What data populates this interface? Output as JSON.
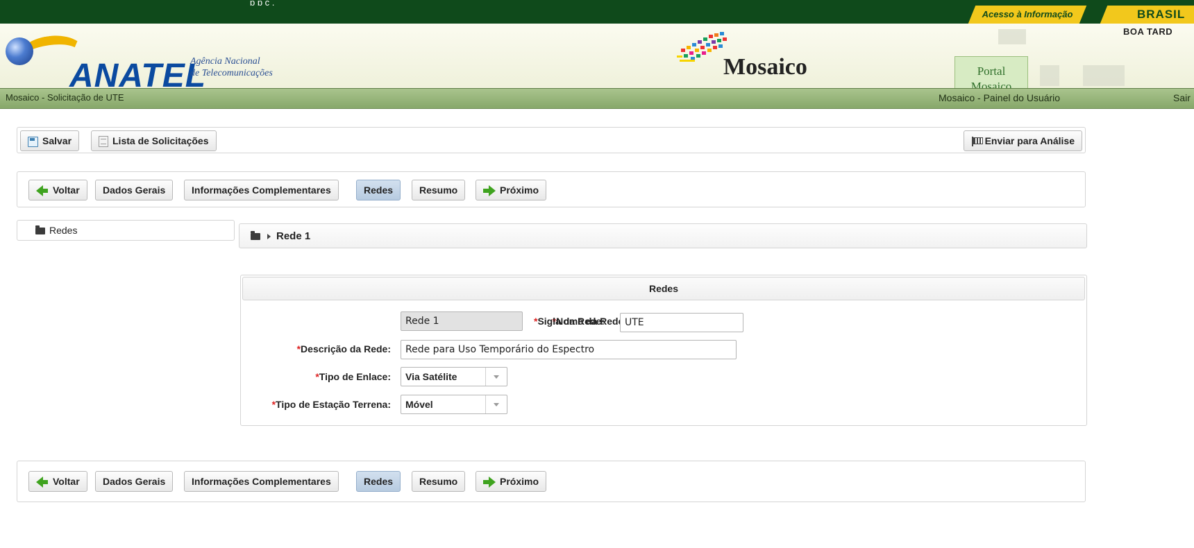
{
  "top_strip": {
    "cut_text": "p  p   ç              ,",
    "acesso": "Acesso à Informação",
    "brasil": "BRASIL"
  },
  "header": {
    "greeting": "BOA TARD",
    "logo_text": "ANATEL",
    "agency_line1": "Agência Nacional",
    "agency_line2": "de Telecomunicações",
    "mosaico_logo": "Mosaico",
    "portal_tab_line1": "Portal",
    "portal_tab_line2": "Mosaico"
  },
  "greenbar": {
    "breadcrumb": "Mosaico - Solicitação de UTE",
    "painel": "Mosaico - Painel do Usuário",
    "sair": "Sair"
  },
  "toolbar": {
    "salvar": "Salvar",
    "lista": "Lista de Solicitações",
    "enviar": "Enviar para Análise"
  },
  "nav": {
    "voltar": "Voltar",
    "dados_gerais": "Dados Gerais",
    "info_compl": "Informações Complementares",
    "redes": "Redes",
    "resumo": "Resumo",
    "proximo": "Próximo"
  },
  "tree": {
    "root": "Redes",
    "node": "Rede 1"
  },
  "form": {
    "title": "Redes",
    "required_mark": "*",
    "nome_label": "Nome da Rede:",
    "nome_value": "Rede 1",
    "sigla_label": "Sigla da Rede:",
    "sigla_value": "UTE",
    "descricao_label": "Descrição da Rede:",
    "descricao_value": "Rede para Uso Temporário do Espectro",
    "enlace_label": "Tipo de Enlace:",
    "enlace_value": "Via Satélite",
    "estacao_label": "Tipo de Estação Terrena:",
    "estacao_value": "Móvel"
  },
  "colors": {
    "top_green": "#0f4a1b",
    "gold": "#f2c81c",
    "nav_active": "#c4d5e8",
    "greenbar": "#97b57a"
  }
}
